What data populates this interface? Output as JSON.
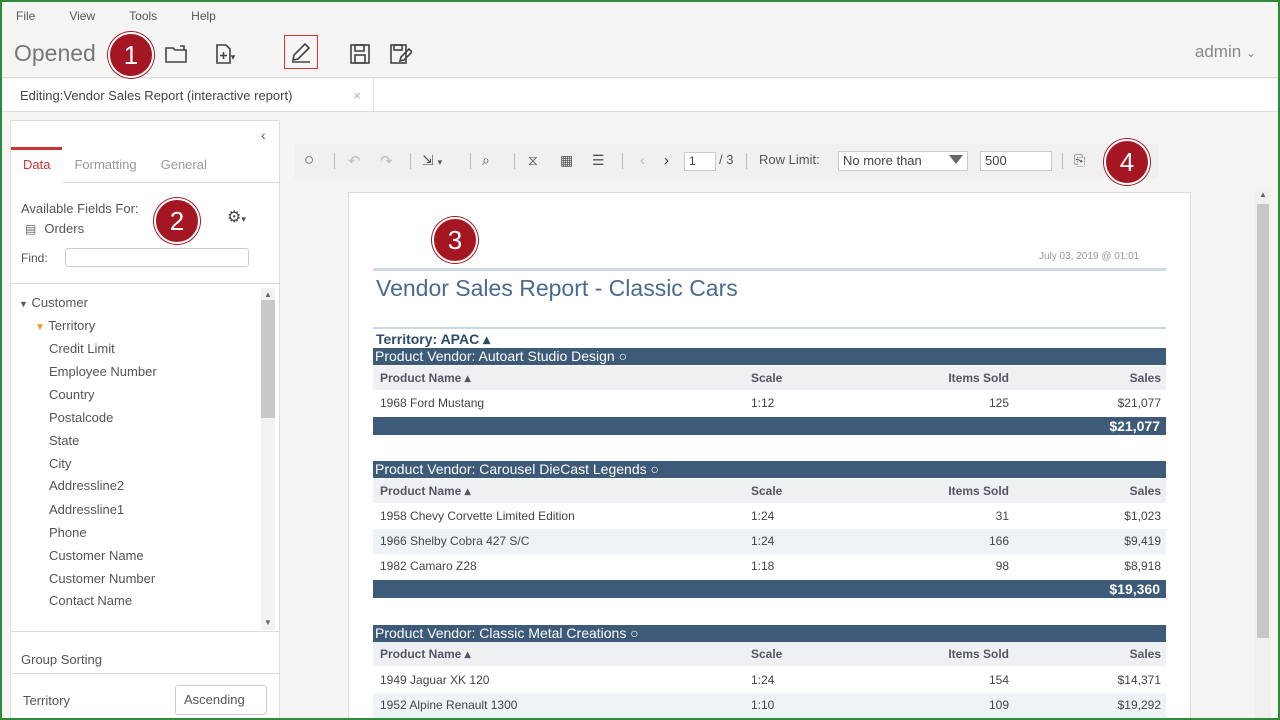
{
  "menu": [
    "File",
    "View",
    "Tools",
    "Help"
  ],
  "toolbar": {
    "opened_label": "Opened",
    "user": "admin"
  },
  "badges": [
    "1",
    "2",
    "3",
    "4"
  ],
  "doc_tab": {
    "label": "Editing:Vendor Sales Report (interactive report)",
    "close": "×"
  },
  "left_panel": {
    "tabs": [
      "Data",
      "Formatting",
      "General"
    ],
    "available_label": "Available Fields For:",
    "source": "Orders",
    "find_label": "Find:",
    "tree": [
      "Customer",
      "Territory",
      "Credit Limit",
      "Employee Number",
      "Country",
      "Postalcode",
      "State",
      "City",
      "Addressline2",
      "Addressline1",
      "Phone",
      "Customer Name",
      "Customer Number",
      "Contact Name"
    ],
    "group_sorting_label": "Group Sorting",
    "sort_field": "Territory",
    "sort_value": "Ascending"
  },
  "report_toolbar": {
    "page_current": "1",
    "page_total": "/ 3",
    "row_limit_label": "Row Limit:",
    "row_limit_select": "No more than",
    "row_limit_value": "500"
  },
  "report": {
    "date": "July 03, 2019 @ 01:01",
    "title": "Vendor Sales Report - Classic Cars",
    "territory": "Territory: APAC ▴",
    "columns": [
      "Product Name ▴",
      "Scale",
      "Items Sold",
      "Sales"
    ],
    "groups": [
      {
        "vendor": "Product Vendor: Autoart Studio Design ○",
        "rows": [
          [
            "1968 Ford Mustang",
            "1:12",
            "125",
            "$21,077"
          ]
        ],
        "total": "$21,077"
      },
      {
        "vendor": "Product Vendor: Carousel DieCast Legends ○",
        "rows": [
          [
            "1958 Chevy Corvette Limited Edition",
            "1:24",
            "31",
            "$1,023"
          ],
          [
            "1966 Shelby Cobra 427 S/C",
            "1:24",
            "166",
            "$9,419"
          ],
          [
            "1982 Camaro Z28",
            "1:18",
            "98",
            "$8,918"
          ]
        ],
        "total": "$19,360"
      },
      {
        "vendor": "Product Vendor: Classic Metal Creations ○",
        "rows": [
          [
            "1949 Jaguar XK 120",
            "1:24",
            "154",
            "$14,371"
          ],
          [
            "1952 Alpine Renault 1300",
            "1:10",
            "109",
            "$19,292"
          ]
        ]
      }
    ]
  }
}
